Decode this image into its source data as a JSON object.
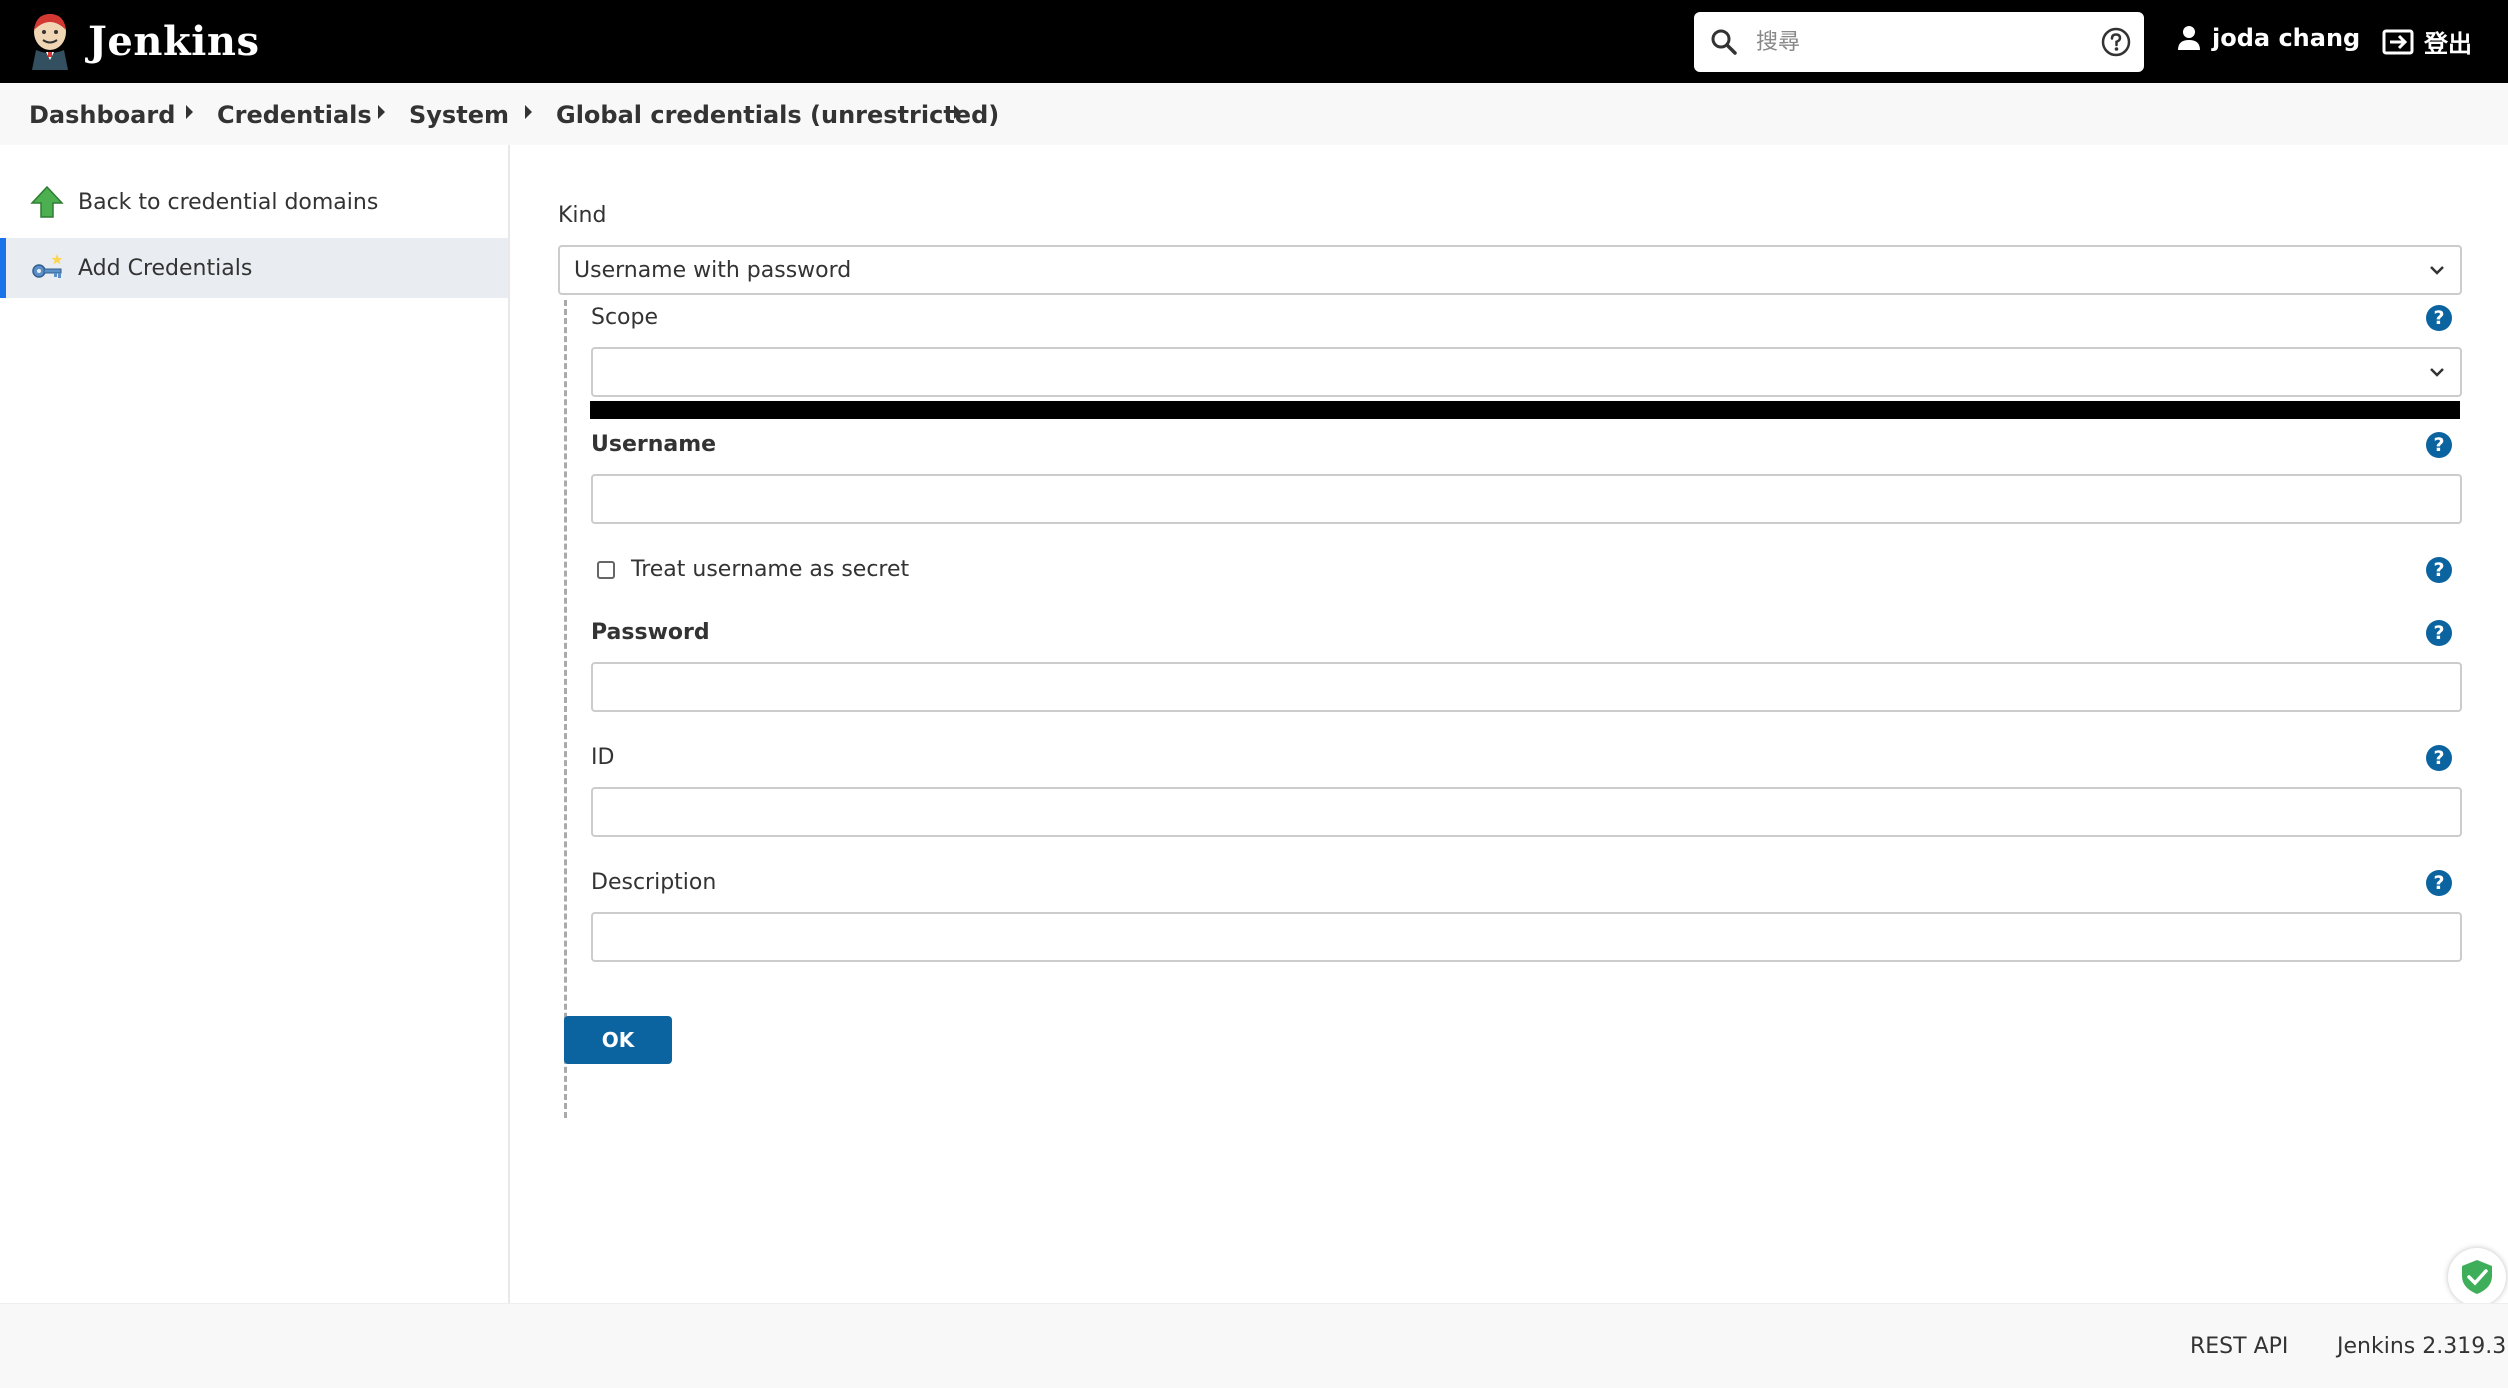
{
  "header": {
    "app_name": "Jenkins",
    "search_placeholder": "搜尋",
    "user_name": "joda chang",
    "logout_label": "登出"
  },
  "breadcrumb": [
    {
      "label": "Dashboard"
    },
    {
      "label": "Credentials"
    },
    {
      "label": "System"
    },
    {
      "label": "Global credentials (unrestricted)"
    }
  ],
  "side_panel": {
    "items": [
      {
        "label": "Back to credential domains",
        "icon": "up-arrow-icon",
        "active": false
      },
      {
        "label": "Add Credentials",
        "icon": "key-icon",
        "active": true
      }
    ]
  },
  "form": {
    "kind_label": "Kind",
    "kind_value": "Username with password",
    "scope_label": "Scope",
    "scope_value": "",
    "username_label": "Username",
    "username_value": "",
    "treat_secret_label": "Treat username as secret",
    "treat_secret_checked": false,
    "password_label": "Password",
    "password_value": "",
    "id_label": "ID",
    "id_value": "",
    "description_label": "Description",
    "description_value": "",
    "ok_label": "OK"
  },
  "footer": {
    "rest_api_label": "REST API",
    "version_label": "Jenkins 2.319.3"
  },
  "colors": {
    "header_bg": "#000000",
    "accent_blue": "#0b64a0",
    "active_border": "#1a73e8",
    "active_bg": "#e9edf1",
    "green_arrow": "#4caf50"
  }
}
